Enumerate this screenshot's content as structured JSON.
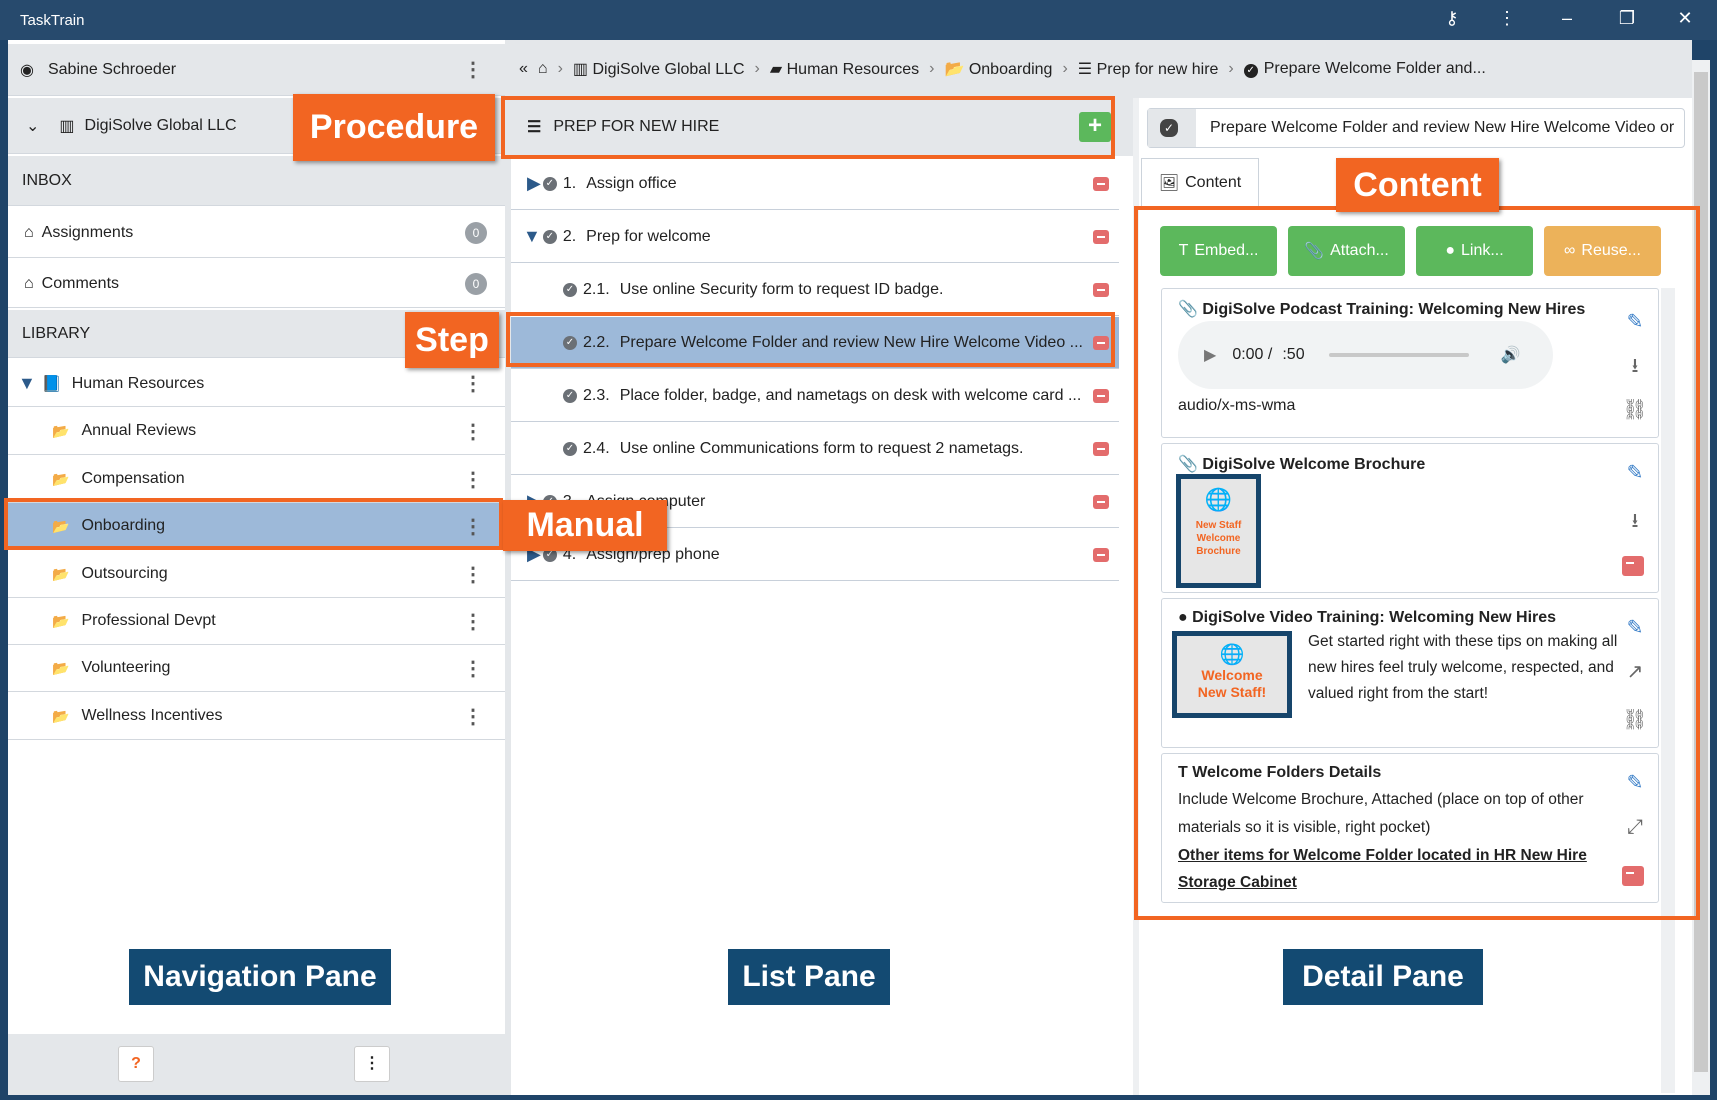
{
  "app": {
    "title": "TaskTrain"
  },
  "nav": {
    "user": "Sabine Schroeder",
    "org": "DigiSolve Global LLC",
    "inbox_header": "INBOX",
    "inbox": [
      {
        "label": "Assignments",
        "count": "0"
      },
      {
        "label": "Comments",
        "count": "0"
      }
    ],
    "library_header": "LIBRARY",
    "library_root": "Human Resources",
    "manuals": [
      "Annual Reviews",
      "Compensation",
      "Onboarding",
      "Outsourcing",
      "Professional Devpt",
      "Volunteering",
      "Wellness Incentives"
    ],
    "selected_manual": "Onboarding"
  },
  "breadcrumb": [
    "DigiSolve Global LLC",
    "Human Resources",
    "Onboarding",
    "Prep for new hire",
    "Prepare Welcome Folder and..."
  ],
  "list": {
    "procedure": "PREP FOR NEW HIRE",
    "steps": [
      {
        "num": "1.",
        "label": "Assign office",
        "level": 0,
        "expander": "collapsed"
      },
      {
        "num": "2.",
        "label": "Prep for welcome",
        "level": 0,
        "expander": "expanded"
      },
      {
        "num": "2.1.",
        "label": "Use online Security form to request ID badge.",
        "level": 1
      },
      {
        "num": "2.2.",
        "label": "Prepare Welcome Folder and review New Hire Welcome Video ...",
        "level": 1,
        "selected": true
      },
      {
        "num": "2.3.",
        "label": "Place folder, badge, and nametags on desk with welcome card ...",
        "level": 1
      },
      {
        "num": "2.4.",
        "label": "Use online Communications form to request 2 nametags.",
        "level": 1
      },
      {
        "num": "3.",
        "label": "Assign computer",
        "level": 0,
        "expander": "collapsed",
        "visible_text": "puter"
      },
      {
        "num": "4.",
        "label": "Assign/prep phone",
        "level": 0,
        "expander": "collapsed"
      }
    ]
  },
  "detail": {
    "step_title": "Prepare Welcome Folder and review New Hire Welcome Video or",
    "tab": "Content",
    "actions": [
      {
        "label": "Embed...",
        "color": "#5cb85c"
      },
      {
        "label": "Attach...",
        "color": "#5cb85c"
      },
      {
        "label": "Link...",
        "color": "#5cb85c"
      },
      {
        "label": "Reuse...",
        "color": "#ecb25a"
      }
    ],
    "cards": [
      {
        "title": "DigiSolve Podcast Training: Welcoming New Hires",
        "audio_time": "0:00 /",
        "audio_duration": ":50",
        "mime": "audio/x-ms-wma"
      },
      {
        "title": "DigiSolve Welcome Brochure",
        "thumb_text": "New Staff Welcome Brochure"
      },
      {
        "title": "DigiSolve Video Training: Welcoming New Hires",
        "thumb_text": "Welcome New Staff!",
        "description": "Get started right with these tips on making all new hires feel truly welcome, respected, and valued right from the start!"
      },
      {
        "title": "Welcome Folders Details",
        "body": "Include Welcome Brochure, Attached (place on top of other materials so it is visible, right pocket)",
        "link": "Other items for Welcome Folder located in HR New Hire Storage Cabinet"
      }
    ]
  },
  "annotations": {
    "procedure": "Procedure",
    "step": "Step",
    "manual": "Manual",
    "content": "Content",
    "nav_pane": "Navigation Pane",
    "list_pane": "List Pane",
    "detail_pane": "Detail Pane"
  },
  "colors": {
    "accent": "#f26522",
    "titlebar": "#274a6d",
    "label_bg": "#134a72",
    "selected": "#9db9d9"
  }
}
